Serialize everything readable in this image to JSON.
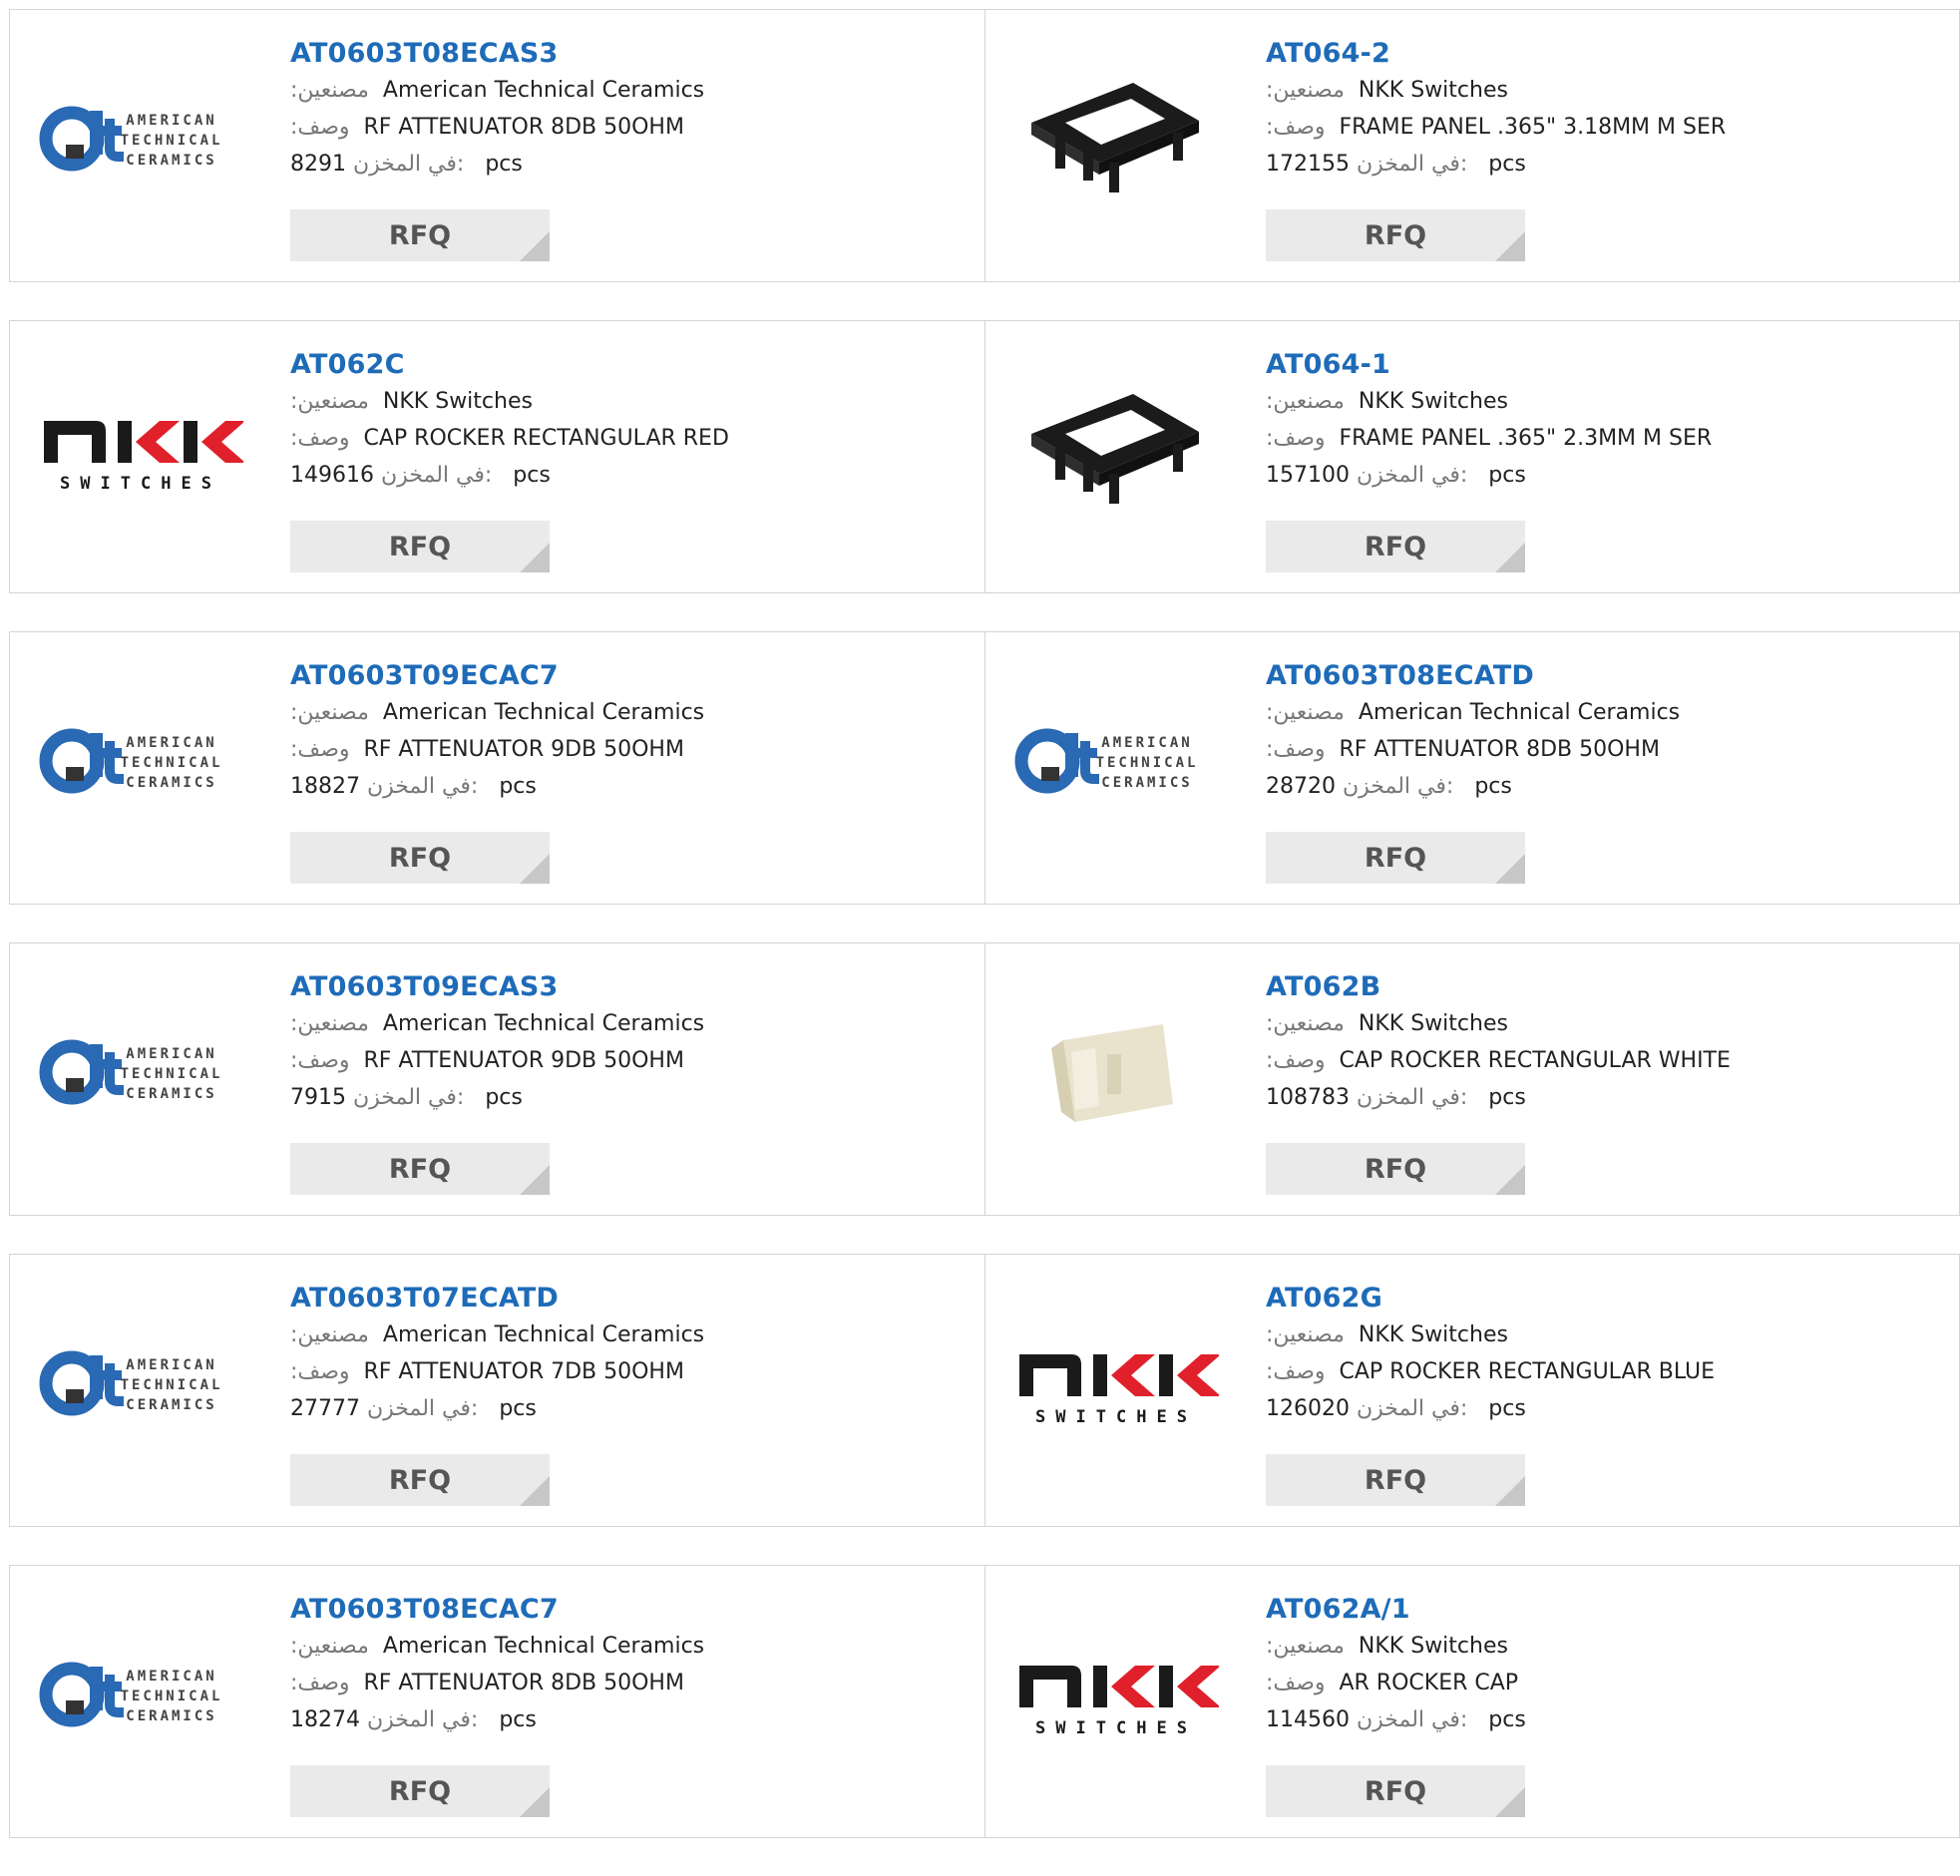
{
  "labels": {
    "manufacturer": ":مصنعين",
    "description": ":وصف",
    "stock": "في المخزن:",
    "unit": "pcs",
    "rfq": "RFQ"
  },
  "logos": {
    "atc": [
      "AMERICAN",
      "TECHNICAL",
      "CERAMICS"
    ],
    "nkk_sub": "SWITCHES"
  },
  "colors": {
    "link": "#1e6bb8",
    "nkk_red": "#e0202a"
  },
  "products": [
    {
      "pn": "AT0603T08ECAS3",
      "mfr": "American Technical Ceramics",
      "desc": "RF ATTENUATOR 8DB 50OHM",
      "stock": "8291",
      "image": "atc-logo"
    },
    {
      "pn": "AT064-2",
      "mfr": "NKK Switches",
      "desc": "FRAME PANEL .365\" 3.18MM M SER",
      "stock": "172155",
      "image": "frame-photo"
    },
    {
      "pn": "AT062C",
      "mfr": "NKK Switches",
      "desc": "CAP ROCKER RECTANGULAR RED",
      "stock": "149616",
      "image": "nkk-logo"
    },
    {
      "pn": "AT064-1",
      "mfr": "NKK Switches",
      "desc": "FRAME PANEL .365\" 2.3MM M SER",
      "stock": "157100",
      "image": "frame-photo"
    },
    {
      "pn": "AT0603T09ECAC7",
      "mfr": "American Technical Ceramics",
      "desc": "RF ATTENUATOR 9DB 50OHM",
      "stock": "18827",
      "image": "atc-logo"
    },
    {
      "pn": "AT0603T08ECATD",
      "mfr": "American Technical Ceramics",
      "desc": "RF ATTENUATOR 8DB 50OHM",
      "stock": "28720",
      "image": "atc-logo"
    },
    {
      "pn": "AT0603T09ECAS3",
      "mfr": "American Technical Ceramics",
      "desc": "RF ATTENUATOR 9DB 50OHM",
      "stock": "7915",
      "image": "atc-logo"
    },
    {
      "pn": "AT062B",
      "mfr": "NKK Switches",
      "desc": "CAP ROCKER RECTANGULAR WHITE",
      "stock": "108783",
      "image": "cap-photo"
    },
    {
      "pn": "AT0603T07ECATD",
      "mfr": "American Technical Ceramics",
      "desc": "RF ATTENUATOR 7DB 50OHM",
      "stock": "27777",
      "image": "atc-logo"
    },
    {
      "pn": "AT062G",
      "mfr": "NKK Switches",
      "desc": "CAP ROCKER RECTANGULAR BLUE",
      "stock": "126020",
      "image": "nkk-logo"
    },
    {
      "pn": "AT0603T08ECAC7",
      "mfr": "American Technical Ceramics",
      "desc": "RF ATTENUATOR 8DB 50OHM",
      "stock": "18274",
      "image": "atc-logo"
    },
    {
      "pn": "AT062A/1",
      "mfr": "NKK Switches",
      "desc": "AR ROCKER CAP",
      "stock": "114560",
      "image": "nkk-logo"
    }
  ]
}
